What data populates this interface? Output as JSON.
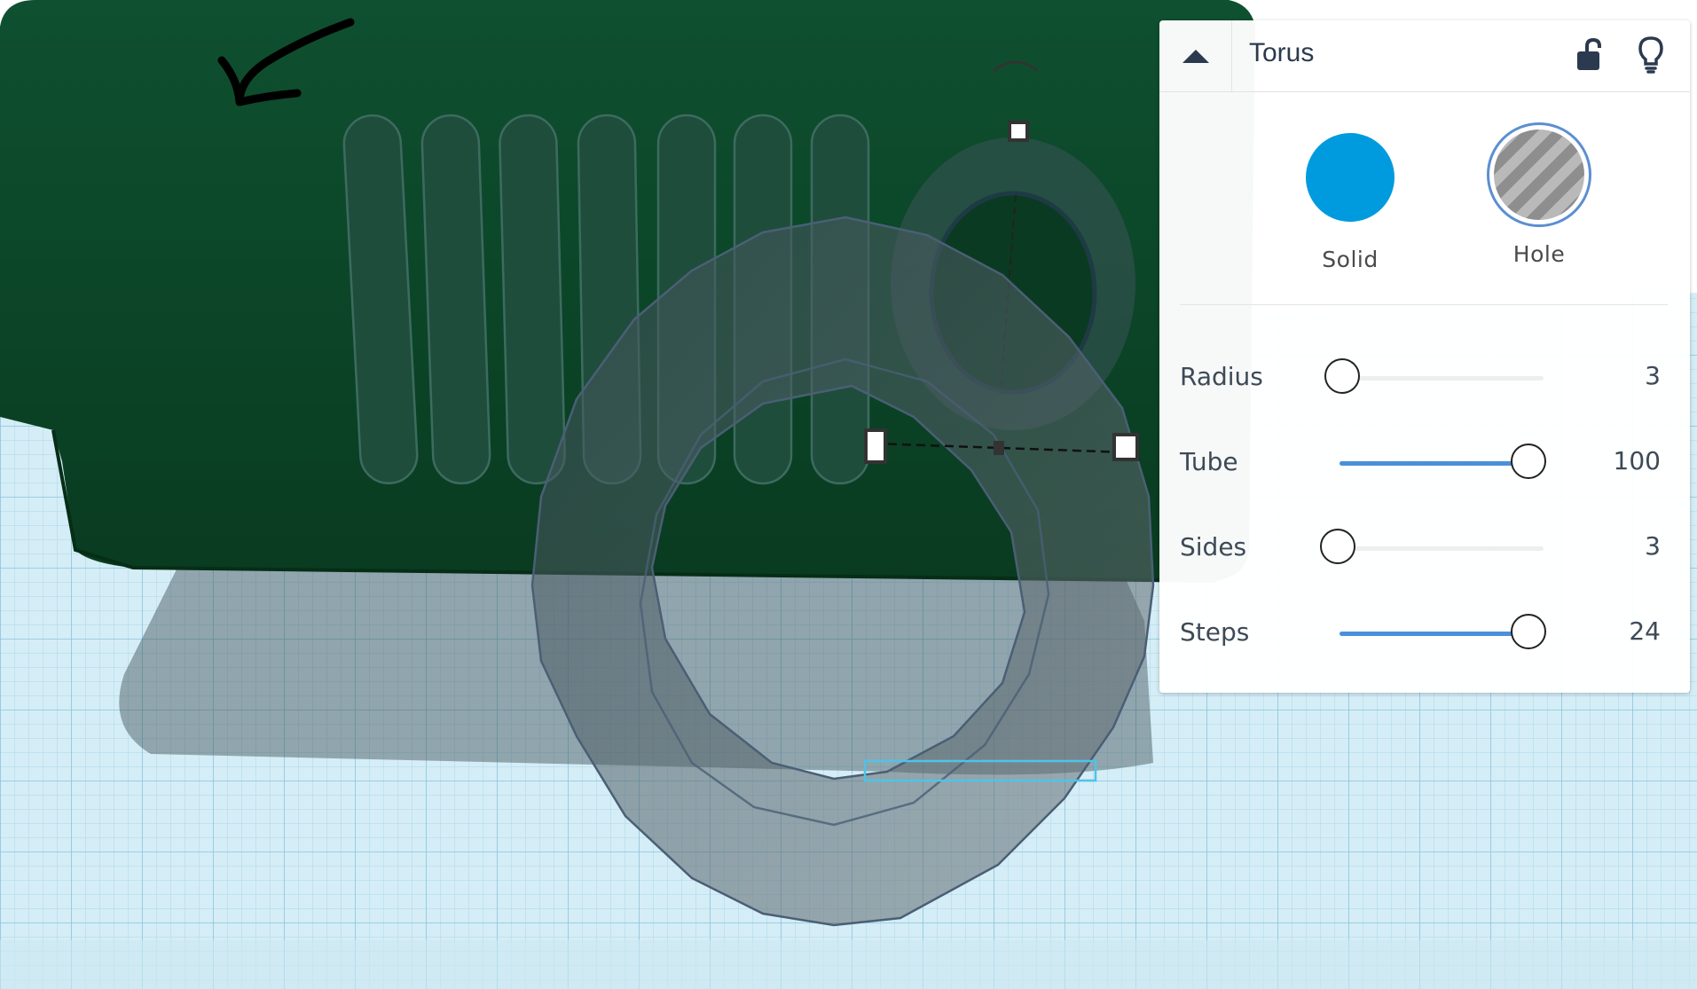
{
  "window": {
    "title": "Torus"
  },
  "header": {
    "collapse_icon": "caret-up-icon",
    "lock_icon": "unlock-icon",
    "hint_icon": "lightbulb-icon"
  },
  "shape_type": {
    "solid": {
      "label": "Solid",
      "color": "#009bde"
    },
    "hole": {
      "label": "Hole",
      "ring_color": "#5b8fd1",
      "selected": true
    }
  },
  "params": [
    {
      "label": "Radius",
      "value": "3",
      "fill_fraction": 0.0
    },
    {
      "label": "Tube",
      "value": "100",
      "fill_fraction": 1.0
    },
    {
      "label": "Sides",
      "value": "3",
      "fill_fraction": 0.0
    },
    {
      "label": "Steps",
      "value": "24",
      "fill_fraction": 1.0
    }
  ],
  "colors": {
    "workplane": "#d3ecf4",
    "grid": "#9fd2e6",
    "green_box": "#0b4425",
    "accent": "#4a90d9"
  }
}
